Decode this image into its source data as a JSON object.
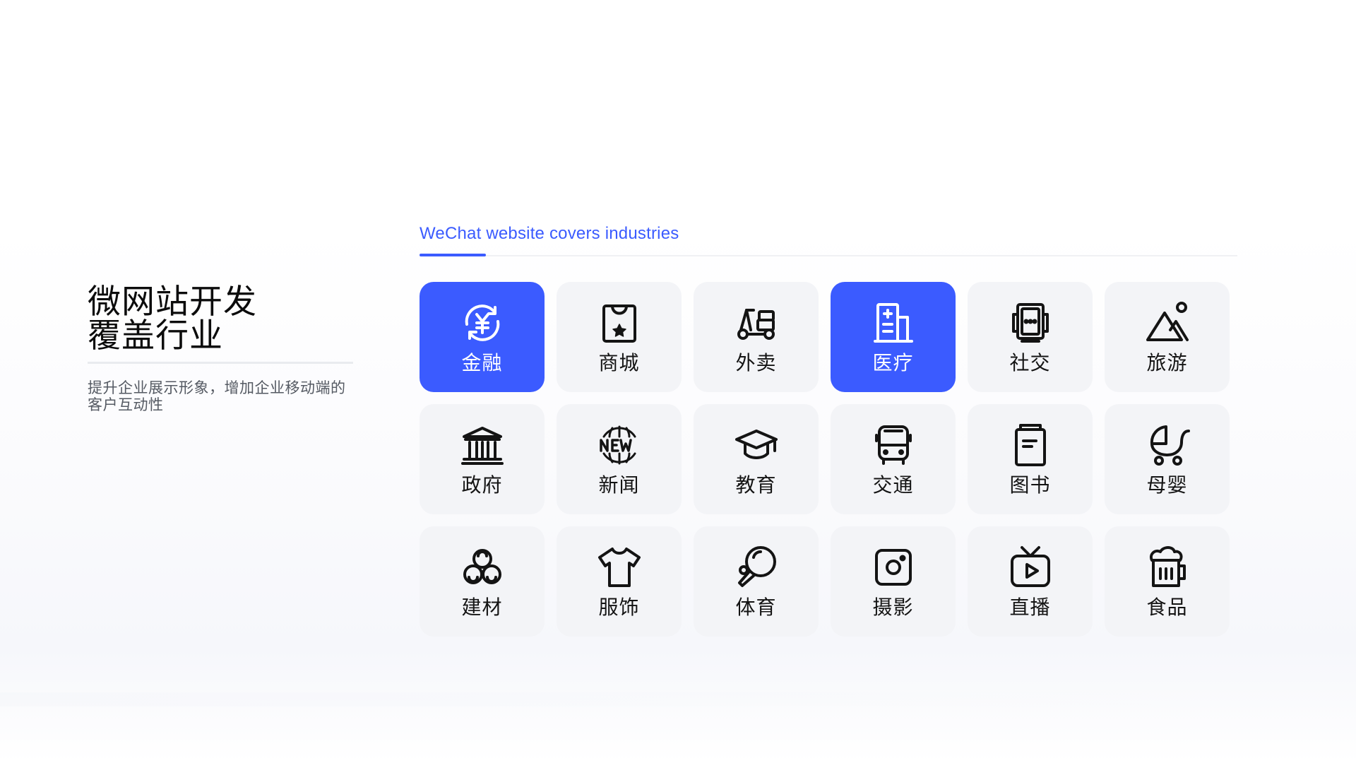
{
  "intro": {
    "title_line1": "微网站开发",
    "title_line2": "覆盖行业",
    "description": "提升企业展示形象，增加企业移动端的客户互动性"
  },
  "tab": {
    "label": "WeChat website covers industries"
  },
  "colors": {
    "accent": "#3b5bff",
    "tile_bg": "#f3f4f7",
    "text": "#141414"
  },
  "industries": [
    {
      "label": "金融",
      "icon": "yen-exchange-icon",
      "active": true
    },
    {
      "label": "商城",
      "icon": "shopping-bag-icon",
      "active": false
    },
    {
      "label": "外卖",
      "icon": "delivery-scooter-icon",
      "active": false
    },
    {
      "label": "医疗",
      "icon": "hospital-icon",
      "active": true
    },
    {
      "label": "社交",
      "icon": "chat-cards-icon",
      "active": false
    },
    {
      "label": "旅游",
      "icon": "mountain-sun-icon",
      "active": false
    },
    {
      "label": "政府",
      "icon": "government-building-icon",
      "active": false
    },
    {
      "label": "新闻",
      "icon": "news-globe-icon",
      "active": false
    },
    {
      "label": "教育",
      "icon": "graduation-cap-icon",
      "active": false
    },
    {
      "label": "交通",
      "icon": "bus-icon",
      "active": false
    },
    {
      "label": "图书",
      "icon": "book-icon",
      "active": false
    },
    {
      "label": "母婴",
      "icon": "baby-stroller-icon",
      "active": false
    },
    {
      "label": "建材",
      "icon": "materials-circles-icon",
      "active": false
    },
    {
      "label": "服饰",
      "icon": "tshirt-icon",
      "active": false
    },
    {
      "label": "体育",
      "icon": "ping-pong-icon",
      "active": false
    },
    {
      "label": "摄影",
      "icon": "camera-icon",
      "active": false
    },
    {
      "label": "直播",
      "icon": "live-tv-icon",
      "active": false
    },
    {
      "label": "食品",
      "icon": "beer-mug-icon",
      "active": false
    }
  ]
}
